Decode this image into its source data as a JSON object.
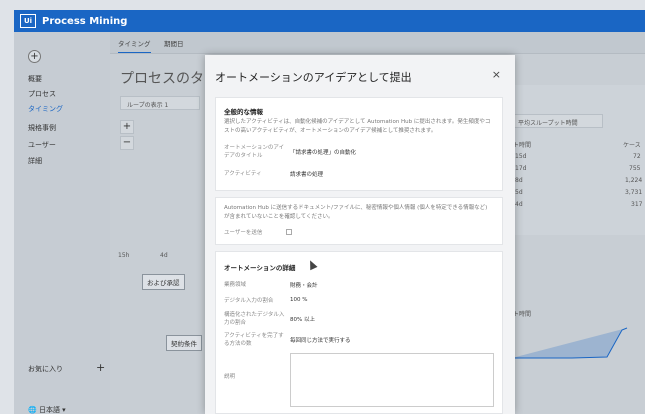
{
  "app": {
    "title": "Process Mining",
    "logo_text": "Ui"
  },
  "sidebar": {
    "items": [
      {
        "label": "概要"
      },
      {
        "label": "プロセス"
      },
      {
        "label": "タイミング"
      },
      {
        "label": "規格事例"
      },
      {
        "label": "ユーザー"
      },
      {
        "label": "詳細"
      }
    ],
    "favorites_label": "お気に入り",
    "language_label": "日本語 ▾"
  },
  "tabs": [
    {
      "label": "タイミング"
    },
    {
      "label": "期間日"
    }
  ],
  "page": {
    "title": "プロセスのタイミ",
    "loop_select": "ループの表示 1",
    "throughput_select": "平均スループット時間",
    "sub_label": "ト時間",
    "case_label": "ケース",
    "rows": [
      {
        "time": "15d",
        "cases": "72"
      },
      {
        "time": "17d",
        "cases": "755"
      },
      {
        "time": "8d",
        "cases": "1,224"
      },
      {
        "time": "5d",
        "cases": "3,731"
      },
      {
        "time": "4d",
        "cases": "317"
      }
    ],
    "node1_label": "および承認",
    "node2_label": "契約条件",
    "edge_label_1": "15h",
    "edge_label_2": "4d",
    "right_label": "ト時間"
  },
  "modal": {
    "title": "オートメーションのアイデアとして提出",
    "close": "×",
    "general": {
      "title": "全般的な情報",
      "description": "選択したアクティビティは、自動化候補のアイデアとして Automation Hub に提出されます。発生頻度やコストの高いアクティビティが、オートメーションのアイデア候補として推奨されます。",
      "idea_title_label": "オートメーションのアイデアのタイトル",
      "idea_title_value": "「請求書の処理」の自動化",
      "activity_label": "アクティビティ",
      "activity_value": "請求書の処理"
    },
    "consent": {
      "text": "Automation Hub に送信するドキュメント/ファイルに、秘密情報や個人情報 (個人を特定できる情報など) が含まれていないことを確認してください。",
      "user_consent_label": "ユーザーを送信"
    },
    "details": {
      "title": "オートメーションの詳細",
      "business_area_label": "業務領域",
      "business_area_value": "財務・会計",
      "digital_input_label": "デジタル入力の割合",
      "digital_input_value": "100 %",
      "structured_input_label": "構造化されたデジタル入力の割合",
      "structured_input_value": "80% 以上",
      "consistency_label": "アクティビティを完了する方法の数",
      "consistency_value": "毎回同じ方法で実行する",
      "description_label": "説明"
    }
  }
}
